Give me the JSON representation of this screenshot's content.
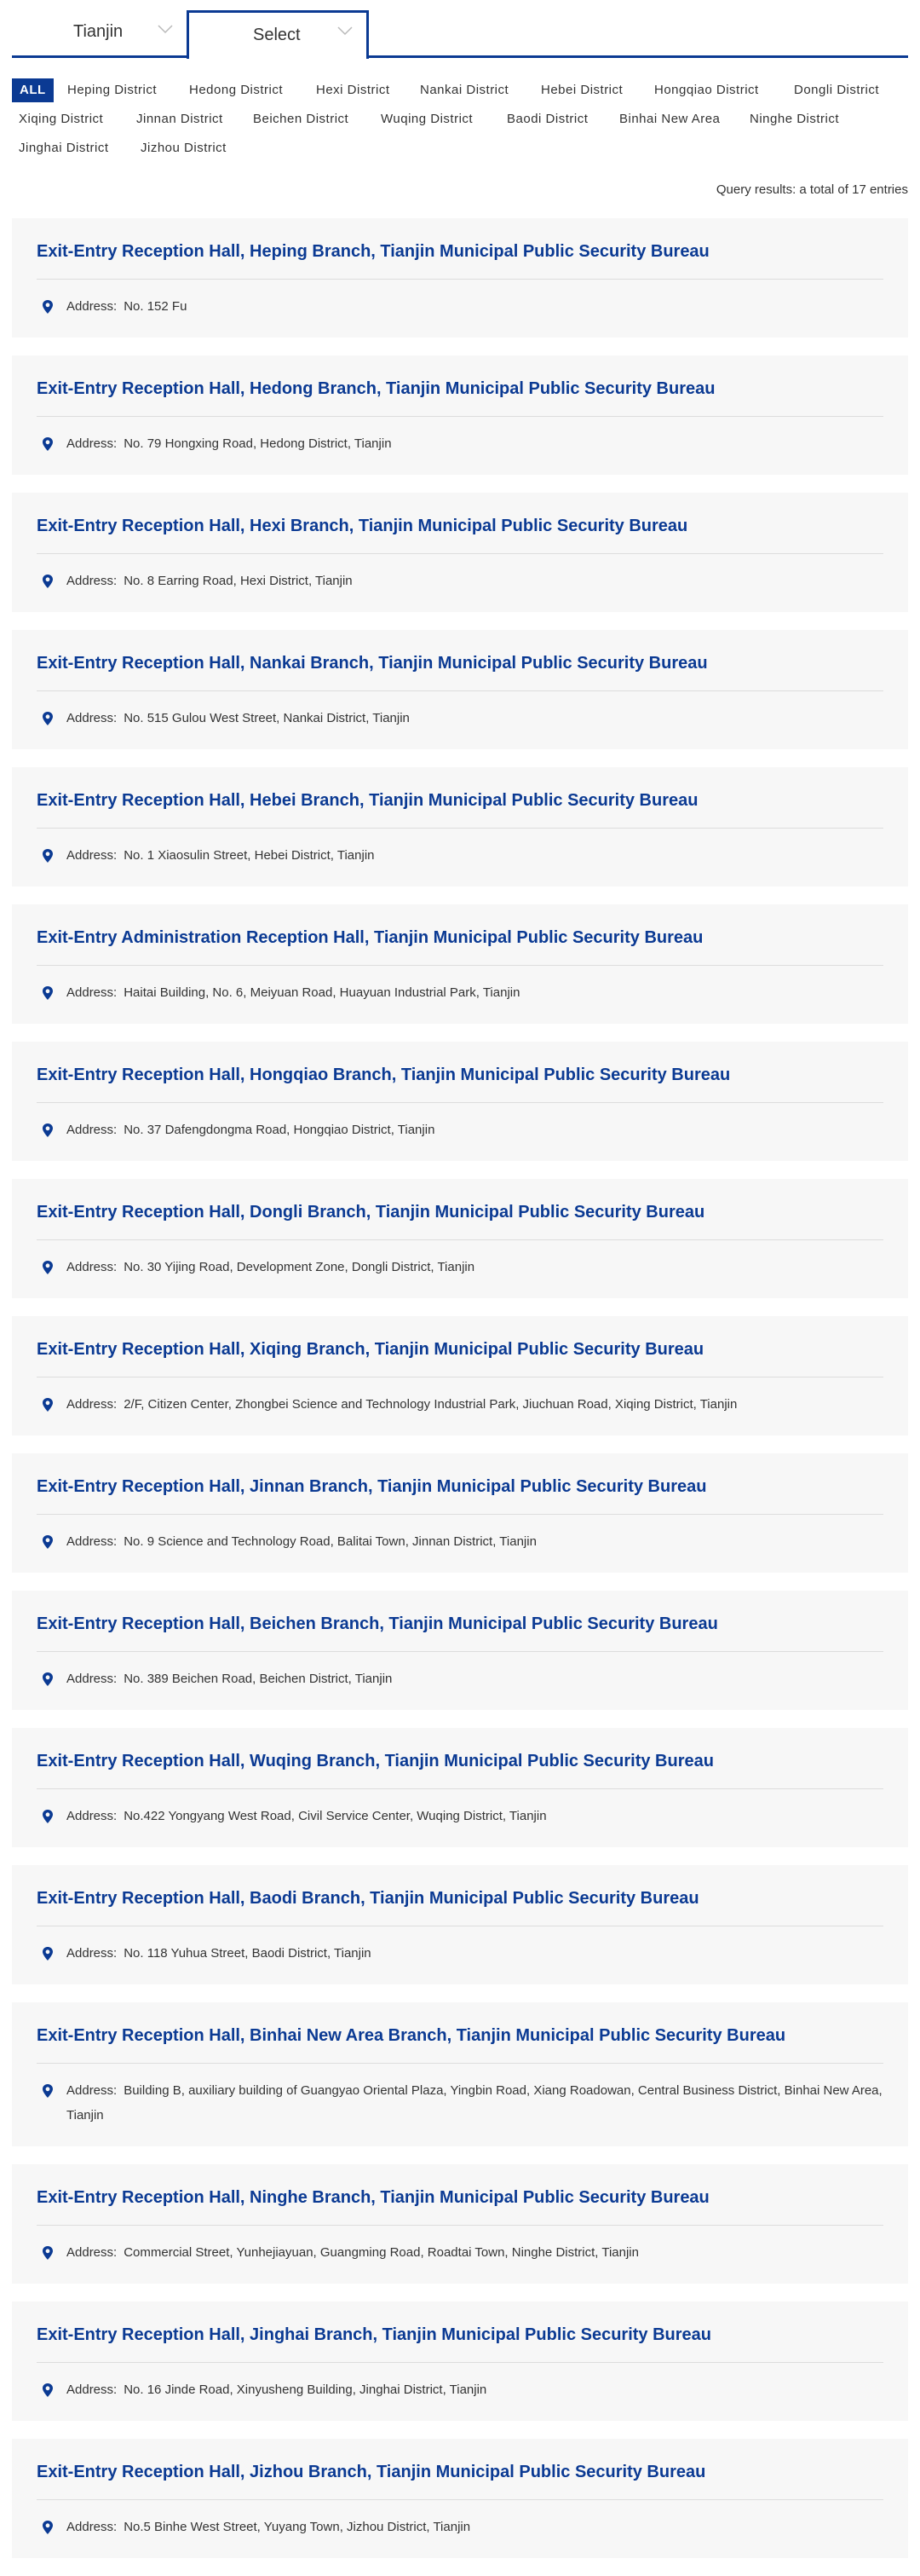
{
  "selector": {
    "city": "Tianjin",
    "select_label": "Select"
  },
  "filters": [
    "ALL",
    "Heping District",
    "Hedong District",
    "Hexi District",
    "Nankai District",
    "Hebei District",
    "Hongqiao District",
    "Dongli District",
    "Xiqing District",
    "Jinnan District",
    "Beichen District",
    "Wuqing District",
    "Baodi District",
    "Binhai New Area",
    "Ninghe District",
    "Jinghai District",
    "Jizhou District"
  ],
  "active_filter": "ALL",
  "results_text": "Query results: a total of 17 entries",
  "address_label": "Address:",
  "icons": {
    "location": "location-pin-icon",
    "dropdown": "chevron-down-icon"
  },
  "colors": {
    "accent": "#0b3a93",
    "card_bg": "#f7f7f7",
    "text": "#333333"
  },
  "entries": [
    {
      "title": "Exit-Entry Reception Hall, Heping Branch, Tianjin Municipal Public Security Bureau",
      "address": "No. 152 Fu"
    },
    {
      "title": "Exit-Entry Reception Hall, Hedong Branch, Tianjin Municipal Public Security Bureau",
      "address": "No. 79 Hongxing Road, Hedong District, Tianjin"
    },
    {
      "title": "Exit-Entry Reception Hall, Hexi Branch, Tianjin Municipal Public Security Bureau",
      "address": "No. 8 Earring Road, Hexi District, Tianjin"
    },
    {
      "title": "Exit-Entry Reception Hall, Nankai Branch, Tianjin Municipal Public Security Bureau",
      "address": "No. 515 Gulou West Street, Nankai District, Tianjin"
    },
    {
      "title": "Exit-Entry Reception Hall, Hebei Branch, Tianjin Municipal Public Security Bureau",
      "address": "No. 1 Xiaosulin Street, Hebei District, Tianjin"
    },
    {
      "title": "Exit-Entry Administration Reception Hall, Tianjin Municipal Public Security Bureau",
      "address": "Haitai Building, No. 6, Meiyuan Road, Huayuan Industrial Park, Tianjin"
    },
    {
      "title": "Exit-Entry Reception Hall, Hongqiao Branch, Tianjin Municipal Public Security Bureau",
      "address": "No. 37 Dafengdongma Road, Hongqiao District,  Tianjin"
    },
    {
      "title": "Exit-Entry Reception Hall, Dongli Branch, Tianjin Municipal Public Security Bureau",
      "address": "No. 30 Yijing Road, Development Zone, Dongli District, Tianjin"
    },
    {
      "title": "Exit-Entry Reception Hall, Xiqing Branch, Tianjin Municipal Public Security Bureau",
      "address": "2/F, Citizen Center, Zhongbei Science and Technology Industrial Park, Jiuchuan Road, Xiqing District, Tianjin"
    },
    {
      "title": "Exit-Entry Reception Hall, Jinnan Branch, Tianjin Municipal Public Security Bureau",
      "address": "No. 9 Science and Technology Road, Balitai Town, Jinnan District, Tianjin"
    },
    {
      "title": "Exit-Entry Reception Hall, Beichen Branch, Tianjin Municipal Public Security Bureau",
      "address": "No. 389 Beichen Road, Beichen District, Tianjin"
    },
    {
      "title": "Exit-Entry Reception Hall, Wuqing Branch, Tianjin Municipal Public Security Bureau",
      "address": "No.422 Yongyang West Road, Civil Service Center, Wuqing District, Tianjin"
    },
    {
      "title": "Exit-Entry Reception Hall, Baodi Branch, Tianjin Municipal Public Security Bureau",
      "address": "No. 118 Yuhua Street, Baodi District, Tianjin"
    },
    {
      "title": "Exit-Entry Reception Hall, Binhai New Area Branch, Tianjin Municipal Public Security Bureau",
      "address": "Building B, auxiliary building of Guangyao Oriental Plaza, Yingbin Road, Xiang Roadowan, Central Business District, Binhai New Area, Tianjin"
    },
    {
      "title": "Exit-Entry Reception Hall, Ninghe Branch, Tianjin Municipal Public Security Bureau",
      "address": "Commercial Street, Yunhejiayuan, Guangming Road, Roadtai Town, Ninghe District, Tianjin"
    },
    {
      "title": "Exit-Entry Reception Hall, Jinghai Branch, Tianjin Municipal Public Security Bureau",
      "address": "No. 16 Jinde Road, Xinyusheng Building, Jinghai District, Tianjin"
    },
    {
      "title": "Exit-Entry Reception Hall, Jizhou Branch, Tianjin Municipal Public Security Bureau",
      "address": "No.5 Binhe West Street, Yuyang Town, Jizhou District, Tianjin"
    }
  ]
}
